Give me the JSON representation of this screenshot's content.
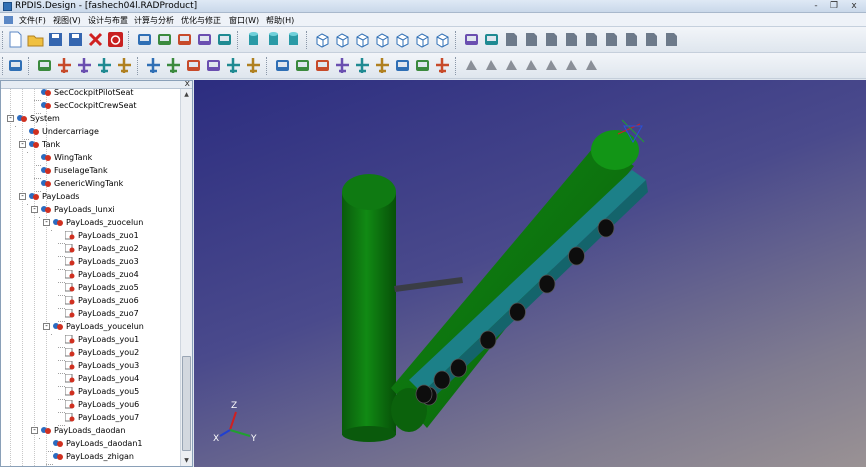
{
  "window": {
    "title": "RPDIS.Design - [fashech04l.RADProduct]",
    "controls": [
      "-",
      "❐",
      "x"
    ]
  },
  "menu": [
    "文件(F)",
    "视图(V)",
    "设计与布置",
    "计算与分析",
    "优化与修正",
    "窗口(W)",
    "帮助(H)"
  ],
  "toolbar1": {
    "icons": [
      "new-file-icon",
      "open-folder-icon",
      "save-icon",
      "save-as-icon",
      "delete-icon",
      "power-icon",
      "zoom-fit-icon",
      "tree-layout-icon",
      "view-full-icon",
      "view-top-icon",
      "view-bottom-icon",
      "cylinder-icon",
      "cylinder-grid-icon",
      "cylinder-arrow-icon",
      "cube-iso-icon",
      "cube-front-icon",
      "cube-back-icon",
      "cube-top-icon",
      "cube-bottom-icon",
      "cube-left-icon",
      "cube-right-icon",
      "layer-a-icon",
      "layer-b-icon",
      "doc-1-icon",
      "doc-2-icon",
      "doc-3-icon",
      "doc-4-icon",
      "doc-5-icon",
      "doc-6-icon",
      "doc-7-icon",
      "doc-8-icon",
      "doc-9-icon"
    ]
  },
  "toolbar2": {
    "icons": [
      "refresh-icon",
      "wing-body-icon",
      "aircraft-a-icon",
      "aircraft-b-icon",
      "aircraft-c-icon",
      "aircraft-d-icon",
      "aircraft-e-icon",
      "aircraft-f-icon",
      "fuselage-a-icon",
      "fuselage-b-icon",
      "aircraft-g-icon",
      "aircraft-h-icon",
      "panel-a-icon",
      "panel-b-icon",
      "panel-c-icon",
      "aircraft-i-icon",
      "aircraft-j-icon",
      "aircraft-k-icon",
      "gear-icon",
      "tank-icon",
      "airplane-outline-icon",
      "component-a-icon",
      "component-b-icon",
      "component-c-icon",
      "component-d-icon",
      "component-e-icon",
      "component-f-icon",
      "component-g-icon"
    ]
  },
  "tree": {
    "panel_close": "x",
    "items": [
      {
        "label": "SecCockpitPilotSeat",
        "level": 2,
        "expander": ""
      },
      {
        "label": "SecCockpitCrewSeat",
        "level": 2,
        "expander": ""
      },
      {
        "label": "System",
        "level": 0,
        "expander": "-"
      },
      {
        "label": "Undercarriage",
        "level": 1,
        "expander": ""
      },
      {
        "label": "Tank",
        "level": 1,
        "expander": "-"
      },
      {
        "label": "WingTank",
        "level": 2,
        "expander": ""
      },
      {
        "label": "FuselageTank",
        "level": 2,
        "expander": ""
      },
      {
        "label": "GenericWingTank",
        "level": 2,
        "expander": ""
      },
      {
        "label": "PayLoads",
        "level": 1,
        "expander": "-"
      },
      {
        "label": "PayLoads_lunxi",
        "level": 2,
        "expander": "-"
      },
      {
        "label": "PayLoads_zuocelun",
        "level": 3,
        "expander": "-"
      },
      {
        "label": "PayLoads_zuo1",
        "level": 4,
        "expander": ""
      },
      {
        "label": "PayLoads_zuo2",
        "level": 4,
        "expander": ""
      },
      {
        "label": "PayLoads_zuo3",
        "level": 4,
        "expander": ""
      },
      {
        "label": "PayLoads_zuo4",
        "level": 4,
        "expander": ""
      },
      {
        "label": "PayLoads_zuo5",
        "level": 4,
        "expander": ""
      },
      {
        "label": "PayLoads_zuo6",
        "level": 4,
        "expander": ""
      },
      {
        "label": "PayLoads_zuo7",
        "level": 4,
        "expander": ""
      },
      {
        "label": "PayLoads_youcelun",
        "level": 3,
        "expander": "-"
      },
      {
        "label": "PayLoads_you1",
        "level": 4,
        "expander": ""
      },
      {
        "label": "PayLoads_you2",
        "level": 4,
        "expander": ""
      },
      {
        "label": "PayLoads_you3",
        "level": 4,
        "expander": ""
      },
      {
        "label": "PayLoads_you4",
        "level": 4,
        "expander": ""
      },
      {
        "label": "PayLoads_you5",
        "level": 4,
        "expander": ""
      },
      {
        "label": "PayLoads_you6",
        "level": 4,
        "expander": ""
      },
      {
        "label": "PayLoads_you7",
        "level": 4,
        "expander": ""
      },
      {
        "label": "PayLoads_daodan",
        "level": 2,
        "expander": "-"
      },
      {
        "label": "PayLoads_daodan1",
        "level": 3,
        "expander": ""
      },
      {
        "label": "PayLoads_zhigan",
        "level": 3,
        "expander": ""
      }
    ]
  },
  "viewport": {
    "axis_labels": {
      "z": "Z",
      "x": "X",
      "y": "Y"
    },
    "colors": {
      "cylinder": "#0f7a12",
      "rail": "#1f8a92",
      "wheel": "#111111",
      "axis_x": "#d02020",
      "axis_y": "#20a030",
      "axis_z": "#2040d0"
    }
  }
}
